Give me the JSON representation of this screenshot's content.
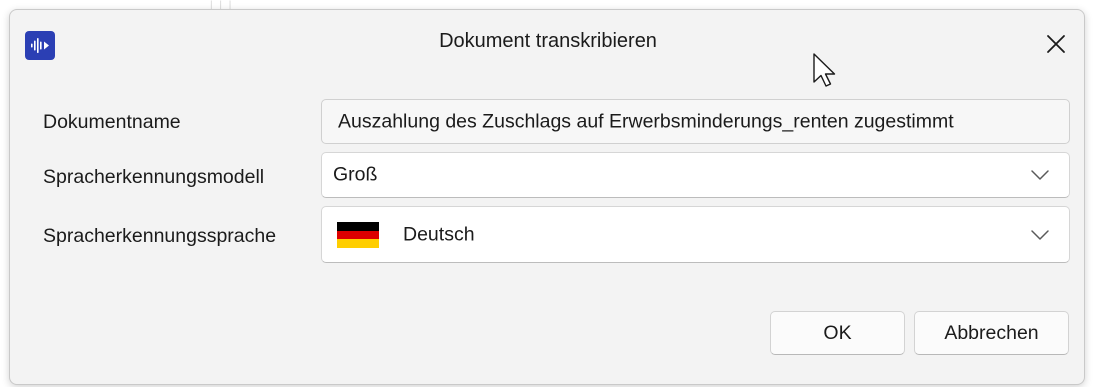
{
  "dialog": {
    "title": "Dokument transkribieren",
    "app_icon": "audio-waveform-icon",
    "close_icon": "close-icon"
  },
  "form": {
    "name_label": "Dokumentname",
    "name_value": "Auszahlung des Zuschlags auf Erwerbsminderungs_renten zugestimmt",
    "model_label": "Spracherkennungsmodell",
    "model_value": "Groß",
    "language_label": "Spracherkennungssprache",
    "language_value": "Deutsch",
    "language_flag": "german-flag-icon"
  },
  "buttons": {
    "ok_label": "OK",
    "cancel_label": "Abbrechen"
  },
  "colors": {
    "accent": "#2b3fb4",
    "dialog_background": "#f3f3f3"
  }
}
